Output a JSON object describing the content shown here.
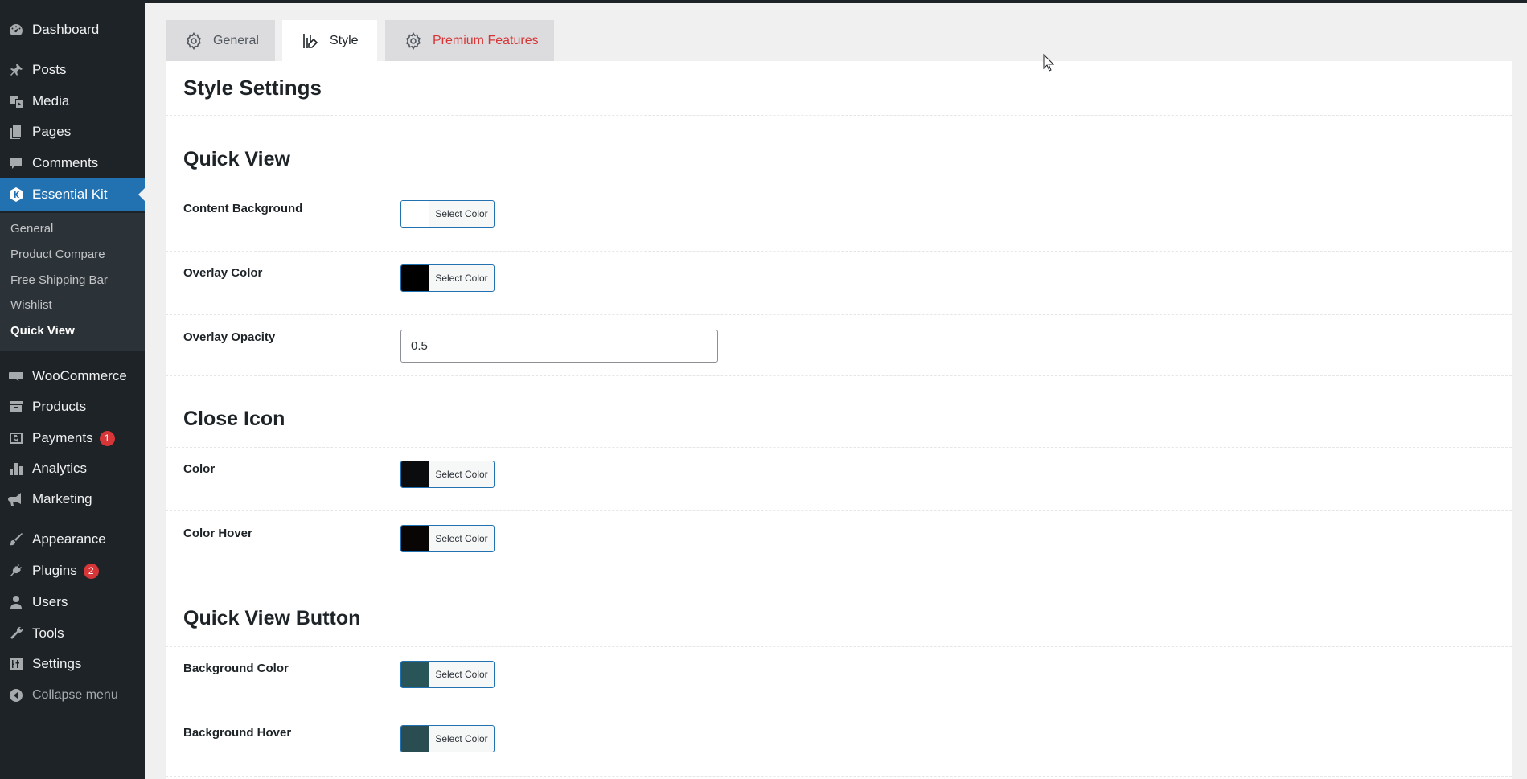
{
  "sidebar": {
    "items": [
      {
        "label": "Dashboard",
        "icon": "dashboard-icon"
      },
      {
        "label": "Posts",
        "icon": "pin-icon"
      },
      {
        "label": "Media",
        "icon": "media-icon"
      },
      {
        "label": "Pages",
        "icon": "pages-icon"
      },
      {
        "label": "Comments",
        "icon": "comment-icon"
      },
      {
        "label": "Essential Kit",
        "icon": "essential-kit-icon"
      },
      {
        "label": "WooCommerce",
        "icon": "woo-icon"
      },
      {
        "label": "Products",
        "icon": "archive-icon"
      },
      {
        "label": "Payments",
        "icon": "payments-icon",
        "badge": "1"
      },
      {
        "label": "Analytics",
        "icon": "chart-icon"
      },
      {
        "label": "Marketing",
        "icon": "megaphone-icon"
      },
      {
        "label": "Appearance",
        "icon": "brush-icon"
      },
      {
        "label": "Plugins",
        "icon": "plug-icon",
        "badge": "2"
      },
      {
        "label": "Users",
        "icon": "user-icon"
      },
      {
        "label": "Tools",
        "icon": "wrench-icon"
      },
      {
        "label": "Settings",
        "icon": "sliders-icon"
      },
      {
        "label": "Collapse menu",
        "icon": "collapse-icon"
      }
    ],
    "submenu": [
      "General",
      "Product Compare",
      "Free Shipping Bar",
      "Wishlist",
      "Quick View"
    ]
  },
  "tabs": [
    {
      "label": "General",
      "icon": "gear-icon"
    },
    {
      "label": "Style",
      "icon": "style-edit-icon"
    },
    {
      "label": "Premium Features",
      "icon": "gear-icon"
    }
  ],
  "page_title": "Style Settings",
  "sections": {
    "quick_view": {
      "title": "Quick View",
      "content_background": {
        "label": "Content Background",
        "color": "#ffffff"
      },
      "overlay_color": {
        "label": "Overlay Color",
        "color": "#000000"
      },
      "overlay_opacity": {
        "label": "Overlay Opacity",
        "value": "0.5"
      }
    },
    "close_icon": {
      "title": "Close Icon",
      "color": {
        "label": "Color",
        "color": "#0a0c0e"
      },
      "color_hover": {
        "label": "Color Hover",
        "color": "#0a0505"
      }
    },
    "quick_view_button": {
      "title": "Quick View Button",
      "background_color": {
        "label": "Background Color",
        "color": "#2a5558"
      },
      "background_hover": {
        "label": "Background Hover",
        "color": "#2a4d52"
      }
    }
  },
  "select_color_label": "Select Color",
  "colors": {
    "sidebar_bg": "#1d2327",
    "submenu_bg": "#2c3338",
    "accent": "#2271b1",
    "badge": "#d63638",
    "premium": "#d63638"
  }
}
